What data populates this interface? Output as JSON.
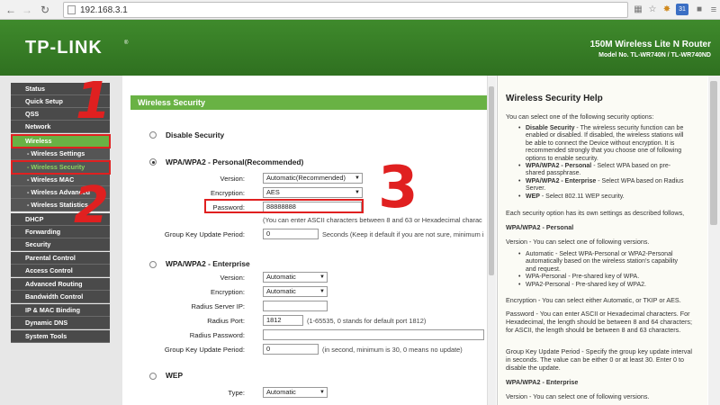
{
  "browser": {
    "url": "192.168.3.1",
    "back_icon": "arrow-left-icon",
    "forward_icon": "arrow-right-icon",
    "reload_icon": "reload-icon",
    "ext_badge": "31"
  },
  "header": {
    "logo": "TP-LINK",
    "product_name": "150M Wireless Lite N Router",
    "model_no": "Model No. TL-WR740N / TL-WR740ND"
  },
  "sidebar": {
    "items": [
      {
        "label": "Status"
      },
      {
        "label": "Quick Setup"
      },
      {
        "label": "QSS"
      },
      {
        "label": "Network"
      },
      {
        "label": "Wireless"
      },
      {
        "label": "- Wireless Settings"
      },
      {
        "label": "- Wireless Security"
      },
      {
        "label": "- Wireless MAC"
      },
      {
        "label": "- Wireless Advanced"
      },
      {
        "label": "- Wireless Statistics"
      },
      {
        "label": "DHCP"
      },
      {
        "label": "Forwarding"
      },
      {
        "label": "Security"
      },
      {
        "label": "Parental Control"
      },
      {
        "label": "Access Control"
      },
      {
        "label": "Advanced Routing"
      },
      {
        "label": "Bandwidth Control"
      },
      {
        "label": "IP & MAC Binding"
      },
      {
        "label": "Dynamic DNS"
      },
      {
        "label": "System Tools"
      }
    ]
  },
  "annotations": {
    "n1": "1",
    "n2": "2",
    "n3": "3"
  },
  "main": {
    "title": "Wireless Security",
    "disable_label": "Disable Security",
    "personal": {
      "label": "WPA/WPA2 - Personal(Recommended)",
      "version_label": "Version:",
      "version_value": "Automatic(Recommended)",
      "encryption_label": "Encryption:",
      "encryption_value": "AES",
      "password_label": "Password:",
      "password_value": "88888888",
      "password_note": "(You can enter ASCII characters between 8 and 63 or Hexadecimal charac",
      "gkup_label": "Group Key Update Period:",
      "gkup_value": "0",
      "gkup_note": "Seconds (Keep it default if you are not sure, minimum is"
    },
    "enterprise": {
      "label": "WPA/WPA2 - Enterprise",
      "version_label": "Version:",
      "version_value": "Automatic",
      "encryption_label": "Encryption:",
      "encryption_value": "Automatic",
      "radius_ip_label": "Radius Server IP:",
      "radius_ip_value": "",
      "radius_port_label": "Radius Port:",
      "radius_port_value": "1812",
      "radius_port_note": "(1-65535, 0 stands for default port 1812)",
      "radius_pw_label": "Radius Password:",
      "radius_pw_value": "",
      "gkup_label": "Group Key Update Period:",
      "gkup_value": "0",
      "gkup_note": "(in second, minimum is 30, 0 means no update)"
    },
    "wep": {
      "label": "WEP",
      "type_label": "Type:",
      "type_value": "Automatic"
    }
  },
  "help": {
    "title": "Wireless Security Help",
    "intro": "You can select one of the following security options:",
    "options": [
      {
        "name": "Disable Security",
        "text": " - The wireless security function can be enabled or disabled. If disabled, the wireless stations will be able to connect the Device without encryption. It is recommended strongly that you choose one of following options to enable security."
      },
      {
        "name": "WPA/WPA2 - Personal",
        "text": " - Select WPA based on pre-shared passphrase."
      },
      {
        "name": "WPA/WPA2 - Enterprise",
        "text": " - Select WPA based on Radius Server."
      },
      {
        "name": "WEP",
        "text": " - Select 802.11 WEP security."
      }
    ],
    "own_settings": "Each security option has its own settings as described follows,",
    "personal_heading": "WPA/WPA2 - Personal",
    "version_intro": "Version - You can select one of following versions.",
    "versions": [
      {
        "text": "Automatic - Select WPA-Personal or WPA2-Personal automatically based on the wireless station's capability and request."
      },
      {
        "text": "WPA-Personal - Pre-shared key of WPA."
      },
      {
        "text": "WPA2-Personal - Pre-shared key of WPA2."
      }
    ],
    "encryption": "Encryption - You can select either Automatic, or TKIP or AES.",
    "password": "Password - You can enter ASCII or Hexadecimal characters. For Hexadecimal, the length should be between 8 and 64 characters; for ASCII, the length should be between 8 and 63 characters.",
    "gkup": "Group Key Update Period - Specify the group key update interval in seconds. The value can be either 0 or at least 30. Enter 0 to disable the update.",
    "enterprise_heading": "WPA/WPA2 - Enterprise",
    "version_intro2": "Version - You can select one of following versions."
  }
}
